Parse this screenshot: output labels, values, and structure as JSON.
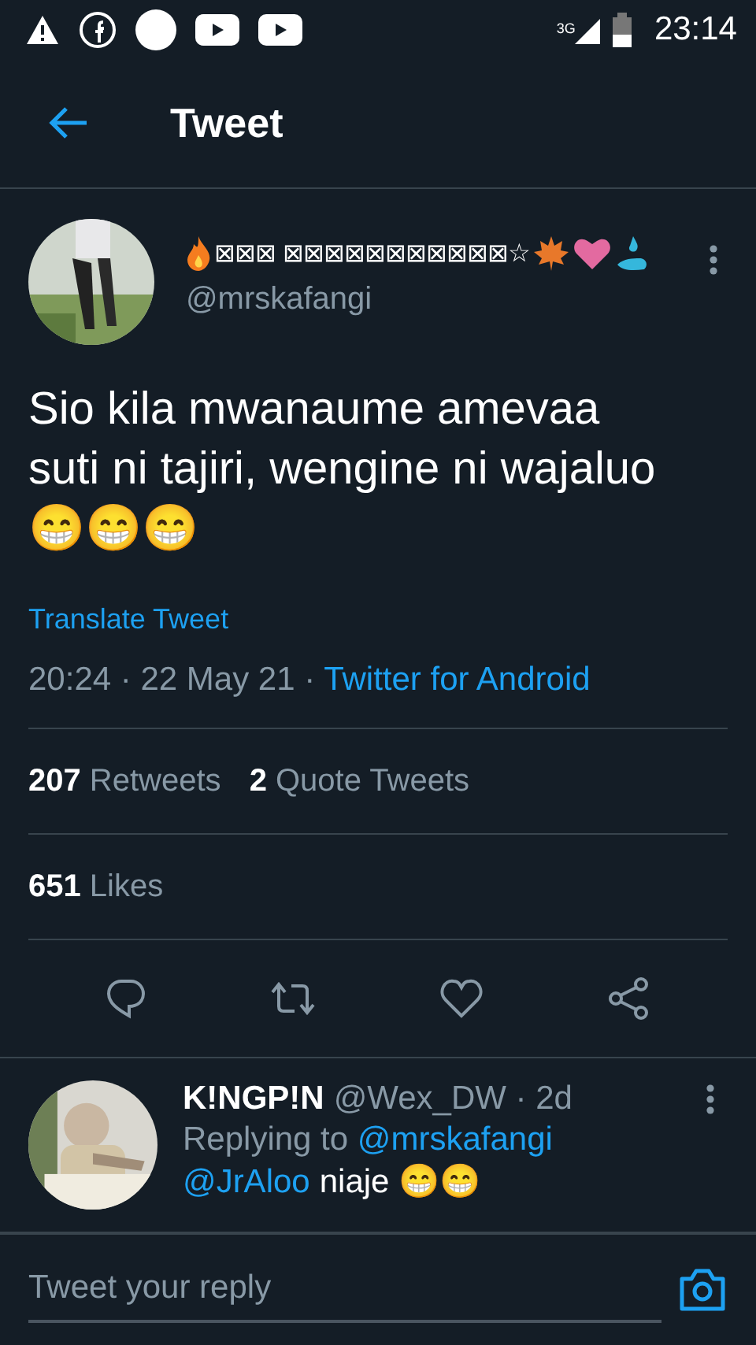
{
  "status_bar": {
    "network": "3G",
    "time": "23:14"
  },
  "header": {
    "title": "Tweet"
  },
  "tweet": {
    "display_name": "⊠⊠⊠ ⊠⊠⊠⊠⊠⊠⊠⊠⊠⊠⊠☆",
    "handle": "@mrskafangi",
    "text": "Sio kila mwanaume amevaa suti ni tajiri, wengine ni wajaluo😁😁😁",
    "translate": "Translate Tweet",
    "time": "20:24 · 22 May 21 · ",
    "source": "Twitter for Android",
    "stats": [
      {
        "text": "**207** Retweets"
      },
      {
        "text": "**2** Quote Tweets"
      }
    ],
    "likes": "**651** Likes"
  },
  "reply": {
    "name": "K!NGP!N",
    "handle": "@Wex_DW · 2d",
    "replying": "Replying to ",
    "replying_to": "@mrskafangi",
    "mention": "@JrAloo",
    "text": "niaje 😁😁"
  },
  "composer": {
    "placeholder": "Tweet your reply"
  }
}
